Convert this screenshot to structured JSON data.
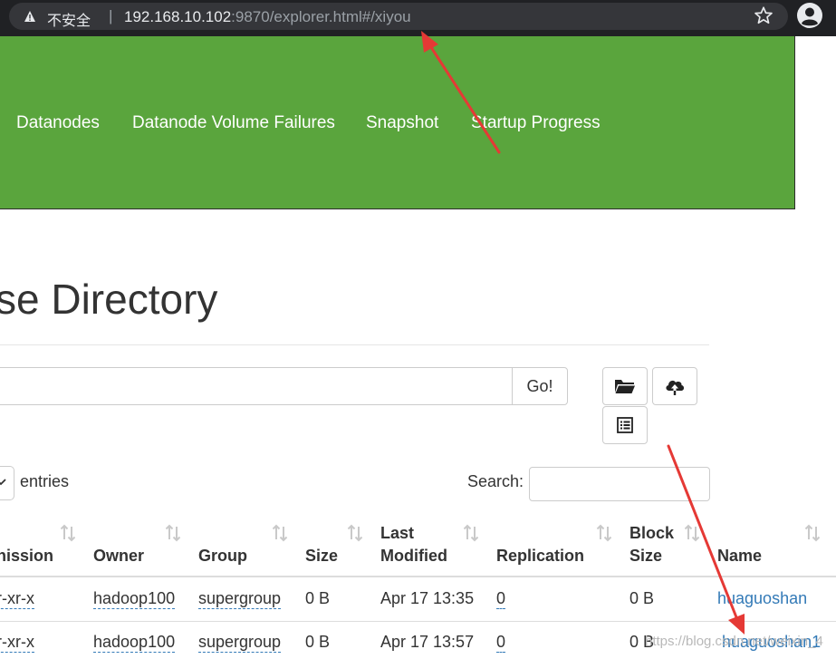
{
  "browser": {
    "insecure_label": "不安全",
    "separator": "|",
    "url_host": "192.168.10.102",
    "url_rest": ":9870/explorer.html#/xiyou"
  },
  "navbar": {
    "items": [
      "Datanodes",
      "Datanode Volume Failures",
      "Snapshot",
      "Startup Progress"
    ]
  },
  "page": {
    "title": "se Directory"
  },
  "path_bar": {
    "value": "",
    "go_label": "Go!"
  },
  "toolbar": {
    "icons": [
      "folder-open-icon",
      "cloud-upload-icon",
      "list-icon"
    ]
  },
  "table_controls": {
    "entries_label": "entries",
    "search_label": "Search:",
    "search_value": ""
  },
  "table": {
    "headers": {
      "permission": "nission",
      "owner": "Owner",
      "group": "Group",
      "size": "Size",
      "last_modified_1": "Last",
      "last_modified_2": "Modified",
      "replication": "Replication",
      "block_size_1": "Block",
      "block_size_2": "Size",
      "name": "Name"
    },
    "rows": [
      {
        "permission": "r-xr-x",
        "owner": "hadoop100",
        "group": "supergroup",
        "size": "0 B",
        "last_modified": "Apr 17 13:35",
        "replication": "0",
        "block_size": "0 B",
        "name": "huaguoshan"
      },
      {
        "permission": "r-xr-x",
        "owner": "hadoop100",
        "group": "supergroup",
        "size": "0 B",
        "last_modified": "Apr 17 13:57",
        "replication": "0",
        "block_size": "0 B",
        "name": "huaguoshan1"
      }
    ]
  },
  "watermark": "https://blog.csdn.net/weixin_4",
  "colors": {
    "navbar": "#5aa53d",
    "link": "#337ab7",
    "annotation_arrow": "#e53935"
  }
}
